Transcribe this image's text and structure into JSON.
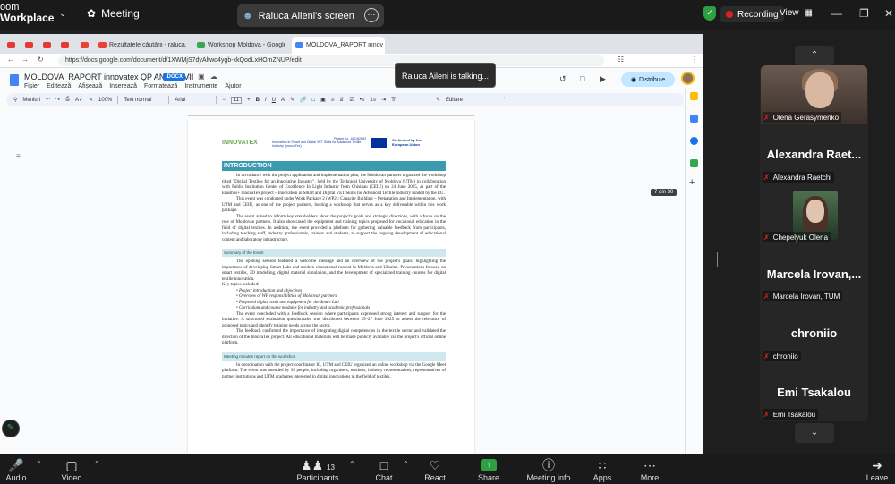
{
  "zoom": {
    "brand_line1": "oom",
    "brand_line2": "Workplace",
    "meeting_label": "Meeting",
    "screen_tab": "Raluca Aileni's screen",
    "recording": "Recording",
    "view": "View",
    "talking": "Raluca Aileni is talking..."
  },
  "browser": {
    "tabs": [
      {
        "label": "Rezultatele căutării - raluca.ma",
        "icon": "gmail-icon"
      },
      {
        "label": "Workshop Moldova - Google D",
        "icon": "drive-icon"
      },
      {
        "label": "MOLDOVA_RAPORT innovatex",
        "icon": "docs-icon"
      }
    ],
    "url": "https://docs.google.com/document/d/1XWMjS7dyAltwo4ygb-xkQodLxHOmZNUP/edit"
  },
  "docs": {
    "title": "MOLDOVA_RAPORT innovatex QP ANNEX VII",
    "badge": ".DOCX",
    "menu": [
      "Fișier",
      "Editează",
      "Afișează",
      "Inserează",
      "Formatează",
      "Instrumente",
      "Ajutor"
    ],
    "share": "Distribuie",
    "toolbar": {
      "search": "Meniuri",
      "zoom": "100%",
      "style": "Text normal",
      "font": "Arial",
      "size": "11",
      "mode": "Editare"
    },
    "page_count": "7 din 30"
  },
  "page": {
    "logo": "INNOVATEX",
    "project_no": "Project no. 101182883",
    "project_title": "Innovation in Smart and Digital VET Skills for Advanced Textile Industry (InnovaTex)",
    "eu_text": "Co-funded by the European Union",
    "h_intro": "INTRODUCTION",
    "intro_p1": "In accordance with the project application and implementation plan, the Moldovan partners organized the workshop titled \"Digital Textiles for an Innovative Industry\", held by the Technical University of Moldova (UTM) in collaboration with Public Institution Center of Excellence In Light Industry from Chisinau (CEIU) on 24 June 2025, as part of the Erasmus+ InnovaTex project – Innovation in Smart and Digital VET Skills for Advanced Textile Industry funded by the EU.",
    "intro_p2": "This event was conducted under Work Package 2 (WP2): Capacity Building – Preparation and Implementation, with UTM and CEIU, as one of the project partners, hosting a workshop that serves as a key deliverable within this work package.",
    "intro_p3": "The event aimed to inform key stakeholders about the project's goals and strategic directions, with a focus on the role of Moldovan partners. It also showcased the equipment and training topics proposed for vocational education in the field of digital textiles. In addition, the event provided a platform for gathering valuable feedback from participants, including teaching staff, industry professionals, trainers and students, to support the ongoing development of educational content and laboratory infrastructure.",
    "h_summary": "Summary of the Event",
    "sum_p1": "The opening session featured a welcome message and an overview of the project's goals, highlighting the importance of developing Smart Labs and modern educational content in Moldova and Ukraine. Presentations focused on smart textiles, 3D modelling, digital material simulation, and the development of specialized training courses for digital textile innovation.",
    "sum_topics": "Key topics included:",
    "bullets": [
      "Project introduction and objectives",
      "Overview of WP responsibilities of Moldovan partners",
      "Proposed digital tools and equipment for the Smart Lab",
      "Curriculum and course modules for industry and academic professionals"
    ],
    "sum_p2": "The event concluded with a feedback session where participants expressed strong interest and support for the initiative. A structured evaluation questionnaire was distributed between 25–27 June 2025 to assess the relevance of proposed topics and identify training needs across the sector.",
    "sum_p3": "The feedback confirmed the importance of integrating digital competencies in the textile sector and validated the direction of the InnovaTex project. All educational materials will be made publicly available via the project's official online platform.",
    "h_minutes": "Meeting minutes report on the workshop",
    "min_p1": "In coordination with the project coordinator IC, UTM and CEIU organized an online workshop via the Google Meet platform. The event was attended by 35 people, including organisers, teachers, industry representatives, representatives of partner institutions and UTM graduates interested in digital innovations in the field of textiles."
  },
  "participants": [
    {
      "display": "",
      "label": "Olena Gerasymenko"
    },
    {
      "display": "Alexandra Raet...",
      "label": "Alexandra Raetchi"
    },
    {
      "display": "",
      "label": "Chepelyuk Olena"
    },
    {
      "display": "Marcela Irovan,...",
      "label": "Marcela Irovan, TUM"
    },
    {
      "display": "chroniio",
      "label": "chroniio"
    },
    {
      "display": "Emi Tsakalou",
      "label": "Emi Tsakalou"
    }
  ],
  "bottom": {
    "audio": "Audio",
    "video": "Video",
    "participants": "Participants",
    "participants_count": "13",
    "chat": "Chat",
    "react": "React",
    "share": "Share",
    "meeting_info": "Meeting info",
    "apps": "Apps",
    "more": "More",
    "leave": "Leave"
  }
}
